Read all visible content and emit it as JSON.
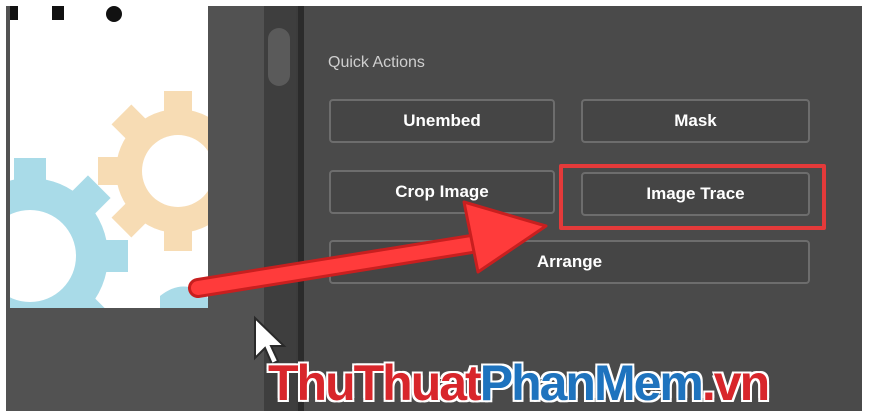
{
  "panel": {
    "title": "Quick Actions",
    "buttons": {
      "unembed": "Unembed",
      "mask": "Mask",
      "crop_image": "Crop Image",
      "image_trace": "Image Trace",
      "arrange": "Arrange"
    }
  },
  "watermark": {
    "part1": "ThuThuat",
    "part2": "PhanMem",
    "part3": ".vn",
    "colors": {
      "red": "#d8262b",
      "blue": "#1e73be"
    }
  },
  "annotation": {
    "highlight_color": "#e43a3a",
    "arrow_color": "#e43a3a"
  },
  "icons": [
    "gear-icon",
    "cursor-icon",
    "arrow-annotation"
  ]
}
